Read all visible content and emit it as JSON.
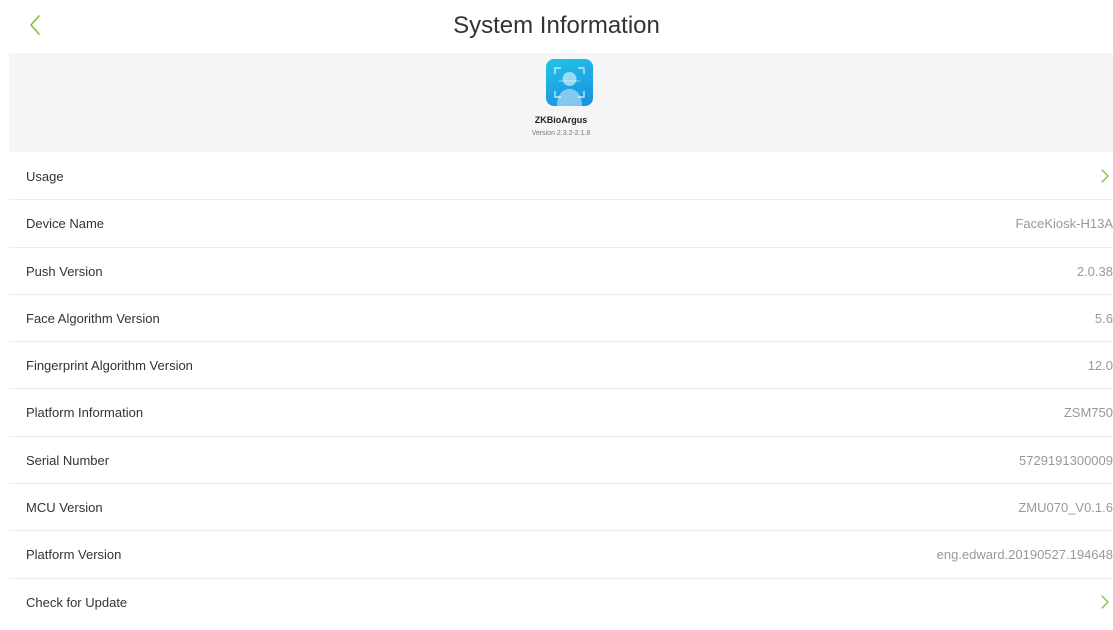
{
  "header": {
    "title": "System Information",
    "back_icon": "chevron-left-icon",
    "accent_color": "#7bc043"
  },
  "app": {
    "name": "ZKBioArgus",
    "version": "Version 2.3.2-2.1.8",
    "icon": "face-scan-icon"
  },
  "rows": [
    {
      "label": "Usage",
      "value": "",
      "chevron": true
    },
    {
      "label": "Device Name",
      "value": "FaceKiosk-H13A",
      "chevron": false
    },
    {
      "label": "Push Version",
      "value": "2.0.38",
      "chevron": false
    },
    {
      "label": "Face Algorithm Version",
      "value": "5.6",
      "chevron": false
    },
    {
      "label": "Fingerprint Algorithm Version",
      "value": "12.0",
      "chevron": false
    },
    {
      "label": "Platform Information",
      "value": "ZSM750",
      "chevron": false
    },
    {
      "label": "Serial Number",
      "value": "5729191300009",
      "chevron": false
    },
    {
      "label": "MCU Version",
      "value": "ZMU070_V0.1.6",
      "chevron": false
    },
    {
      "label": "Platform Version",
      "value": "eng.edward.20190527.194648",
      "chevron": false
    },
    {
      "label": "Check for Update",
      "value": "",
      "chevron": true
    }
  ]
}
